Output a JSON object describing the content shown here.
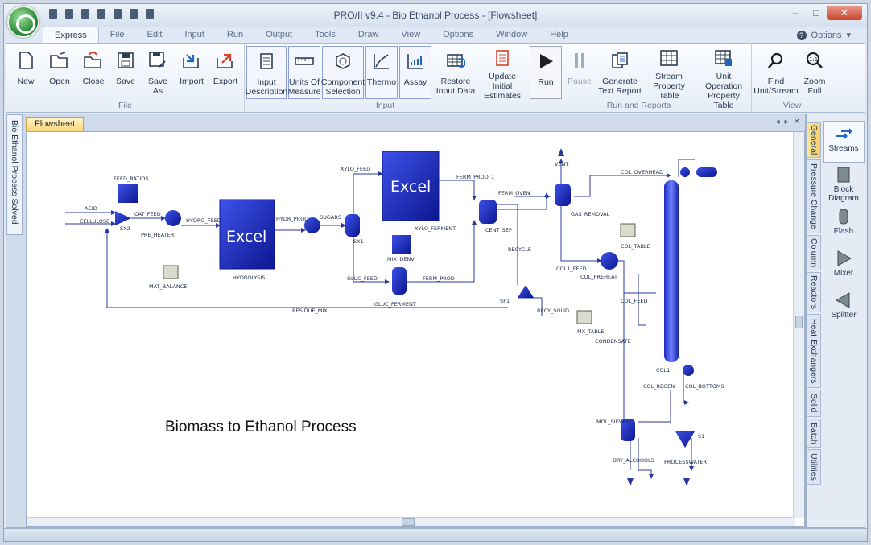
{
  "window": {
    "title": "PRO/II v9.4 - Bio Ethanol Process - [Flowsheet]",
    "controls": {
      "minimize": "–",
      "maximize": "□",
      "close": "✕"
    }
  },
  "menu": {
    "tabs": [
      "Express",
      "File",
      "Edit",
      "Input",
      "Run",
      "Output",
      "Tools",
      "Draw",
      "View",
      "Options",
      "Window",
      "Help"
    ],
    "help_icon": "?",
    "options_label": "Options"
  },
  "ribbon": {
    "groups": {
      "file": "File",
      "input": "Input",
      "run": "Run and Reports",
      "view": "View"
    },
    "buttons": {
      "new": "New",
      "open": "Open",
      "close": "Close",
      "save": "Save",
      "save_as_1": "Save",
      "save_as_2": "As",
      "import": "Import",
      "export": "Export",
      "input_desc_1": "Input",
      "input_desc_2": "Description",
      "units_1": "Units Of",
      "units_2": "Measure",
      "component_1": "Component",
      "component_2": "Selection",
      "thermo": "Thermo",
      "assay": "Assay",
      "restore_1": "Restore",
      "restore_2": "Input Data",
      "update_1": "Update Initial",
      "update_2": "Estimates",
      "run": "Run",
      "pause": "Pause",
      "gen_report_1": "Generate",
      "gen_report_2": "Text Report",
      "stream_table_1": "Stream",
      "stream_table_2": "Property Table",
      "unit_op_1": "Unit Operation",
      "unit_op_2": "Property Table",
      "find_1": "Find",
      "find_2": "Unit/Stream",
      "zoom_1": "Zoom",
      "zoom_2": "Full"
    }
  },
  "left_panel": {
    "label": "Bio Ethanol Process Solved"
  },
  "document": {
    "tab": "Flowsheet",
    "caption": "Biomass to Ethanol Process",
    "excel_label": "Excel",
    "units": {
      "hydrolysis": "HYDROLYSIS",
      "xylo_ferment": "XYLO_FERMENT",
      "gluc_ferment": "GLUC_FERMENT",
      "col1": "COL1",
      "mol_sieves": "MOL_SIEVES",
      "sp1": "SP1",
      "gas_removal": "GAS_REMOVAL",
      "col_reboiler": "COL_PREHEAT",
      "mat_balance": "MAT_BALANCE",
      "col_table": "COL_TABLE",
      "mx_table": "MX_TABLE",
      "process_water": "PROCESSWATER",
      "centrifuge": "CENT_SEP",
      "vent": "VENT"
    },
    "streams": {
      "acid": "ACID",
      "cellulose": "CELLULOSE",
      "feed_ratios": "FEED_RATIOS",
      "cat_feed": "CAT_FEED",
      "pre_heater": "PRE_HEATER",
      "hydro_feed": "HYDRO_FEED",
      "hydr_prod": "HYDR_PROD",
      "sugars": "SUGARS",
      "xylo_feed": "XYLO_FEED",
      "ferm_prod": "FERM_PROD_1",
      "ferm_oven": "FERM_OVEN",
      "gluc_feed": "GLUC_FEED",
      "ferm_prod2": "FERM_PROD",
      "recycle": "RECYCLE",
      "residue_mix": "RESIDUE_MIX",
      "recy_solid": "RECY_SOLID",
      "col_overhead": "COL_OVERHEAD",
      "col_feed": "COL1_FEED",
      "col_feed2": "COL_FEED",
      "condensate": "CONDENSATE",
      "col_bottoms": "COL_BOTTOMS",
      "col_regen": "COL_REGEN",
      "dry_alcohols": "DRY_ALCOHOLS",
      "s1": "S1",
      "sx1": "SX1",
      "sx2": "SX2",
      "mix_ratio": "MIX_DENV"
    }
  },
  "palette": {
    "categories": [
      "General",
      "Pressure Change",
      "Column",
      "Reactors",
      "Heat Exchangers",
      "Solid",
      "Batch",
      "Utilities"
    ],
    "items": [
      "Streams",
      "Block Diagram",
      "Flash",
      "Mixer",
      "Splitter"
    ]
  },
  "colors": {
    "accent": "#1f2fd6",
    "stream": "#2a3a9c",
    "tab_active": "#f5cf66"
  }
}
